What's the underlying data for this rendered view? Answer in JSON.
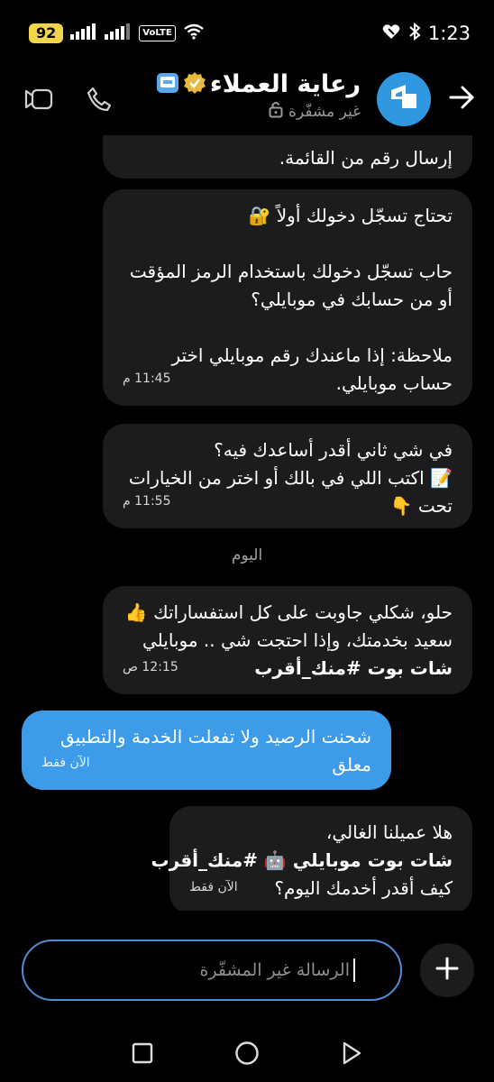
{
  "status_bar": {
    "battery": "92",
    "network_badge": "VoLTE",
    "time": "1:23",
    "icons": [
      "signal-icon",
      "wifi-icon",
      "bluetooth-icon",
      "vibrate-icon",
      "message-icon"
    ]
  },
  "header": {
    "title": "رعاية العملاء",
    "subtitle": "غير مشفّرة",
    "icons": [
      "back-arrow-icon",
      "verified-icon",
      "lock-icon",
      "phone-icon",
      "video-icon"
    ]
  },
  "messages": [
    {
      "direction": "received",
      "lines": [
        "إرسال رقم من القائمة."
      ],
      "time": ""
    },
    {
      "direction": "received",
      "lines": [
        "تحتاج تسجّل دخولك أولاً 🔐",
        "",
        "حاب تسجّل دخولك باستخدام الرمز المؤقت",
        "أو من حسابك في موبايلي؟",
        "",
        "ملاحظة: إذا ماعندك رقم موبايلي اختر",
        "حساب موبايلي."
      ],
      "time": "11:45 م"
    },
    {
      "direction": "received",
      "lines": [
        "في شي ثاني أقدر أساعدك فيه؟",
        "📝 اكتب اللي في بالك أو اختر من الخيارات",
        "تحت 👇"
      ],
      "time": "11:55 م"
    },
    {
      "direction": "received",
      "lines": [
        "حلو، شكلي جاوبت على كل استفساراتك 👍",
        "سعيد بخدمتك، وإذا احتجت شي .. موبايلي",
        "شات بوت #منك_أقرب"
      ],
      "time": "12:15 ص"
    },
    {
      "direction": "sent",
      "lines": [
        "شحنت الرصيد ولا تفعلت الخدمة والتطبيق",
        "معلق"
      ],
      "time": "الآن فقط"
    },
    {
      "direction": "received",
      "lines": [
        "هلا عميلنا الغالي،",
        "شات بوت موبايلي 🤖 #منك_أقرب",
        "كيف أقدر أخدمك اليوم؟"
      ],
      "time": "الآن فقط"
    }
  ],
  "day_separator": "اليوم",
  "composer": {
    "placeholder": "الرسالة غير المشفّرة",
    "icons": [
      "plus-icon"
    ]
  },
  "nav_bar": {
    "icons": [
      "recents-square-icon",
      "home-circle-icon",
      "back-triangle-icon"
    ]
  },
  "colors": {
    "background": "#000000",
    "received_bubble": "#1c1c1e",
    "sent_bubble": "#3d9be9",
    "accent": "#2f98e0"
  }
}
